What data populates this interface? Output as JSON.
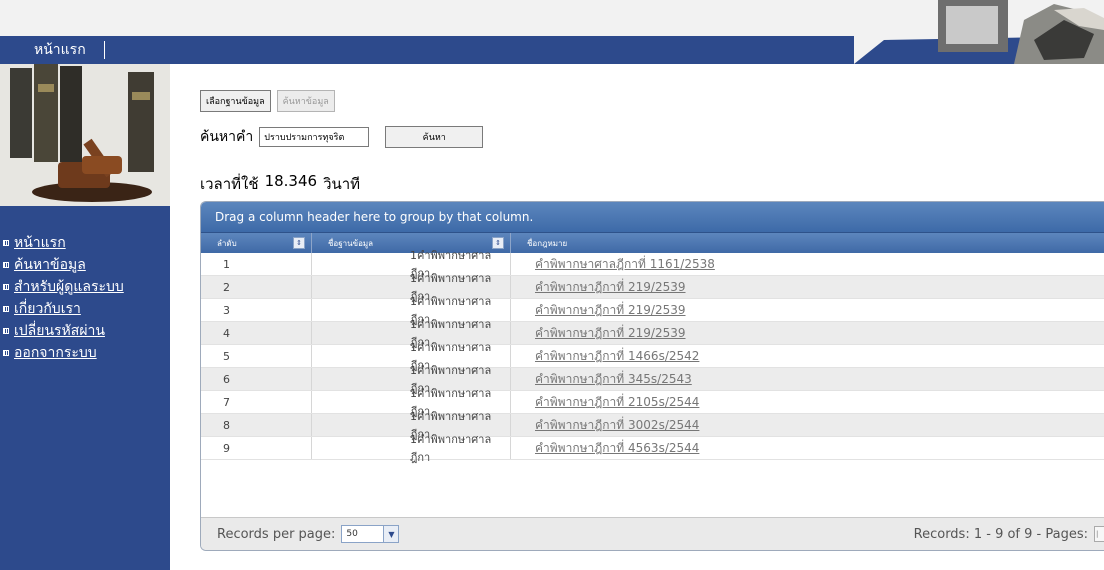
{
  "nav": {
    "home": "หน้าแรก"
  },
  "sidebar": {
    "items": [
      {
        "label": "หน้าแรก"
      },
      {
        "label": "ค้นหาข้อมูล"
      },
      {
        "label": "สำหรับผู้ดูแลระบบ"
      },
      {
        "label": "เกี่ยวกับเรา"
      },
      {
        "label": "เปลี่ยนรหัสผ่าน"
      },
      {
        "label": "ออกจากระบบ"
      }
    ]
  },
  "buttons": {
    "select_db": "เลือกฐานข้อมูล",
    "search_data": "ค้นหาข้อมูล"
  },
  "search": {
    "label": "ค้นหาคำ",
    "value": "ปราบปรามการทุจริต",
    "button": "ค้นหา"
  },
  "time": {
    "label": "เวลาที่ใช้",
    "value": "18.346",
    "unit": "วินาที"
  },
  "grid": {
    "group_hint": "Drag a column header here to group by that column.",
    "columns": [
      "ลำดับ",
      "ชื่อฐานข้อมูล",
      "ชื่อกฎหมาย"
    ],
    "rows": [
      {
        "no": "1",
        "db": "1คำพิพากษาศาลฎีกา",
        "law": "คำพิพากษาศาลฎีกาที่  1161/2538"
      },
      {
        "no": "2",
        "db": "1คำพิพากษาศาลฎีกา",
        "law": "คำพิพากษาฎีกาที่  219/2539"
      },
      {
        "no": "3",
        "db": "1คำพิพากษาศาลฎีกา",
        "law": "คำพิพากษาฎีกาที่  219/2539"
      },
      {
        "no": "4",
        "db": "1คำพิพากษาศาลฎีกา",
        "law": "คำพิพากษาฎีกาที่  219/2539"
      },
      {
        "no": "5",
        "db": "1คำพิพากษาศาลฎีกา",
        "law": "คำพิพากษาฎีกาที่  1466s/2542"
      },
      {
        "no": "6",
        "db": "1คำพิพากษาศาลฎีกา",
        "law": "คำพิพากษาฎีกาที่  345s/2543"
      },
      {
        "no": "7",
        "db": "1คำพิพากษาศาลฎีกา",
        "law": "คำพิพากษาฎีกาที่  2105s/2544"
      },
      {
        "no": "8",
        "db": "1คำพิพากษาศาลฎีกา",
        "law": "คำพิพากษาฎีกาที่  3002s/2544"
      },
      {
        "no": "9",
        "db": "1คำพิพากษาศาลฎีกา",
        "law": "คำพิพากษาฎีกาที่  4563s/2544"
      }
    ],
    "footer": {
      "per_page_label": "Records per page:",
      "per_page_value": "50",
      "records_text": "Records: 1 - 9 of 9 - Pages:"
    }
  },
  "colors": {
    "nav_blue": "#2d4a8c",
    "grid_header": "#4a74ae"
  }
}
